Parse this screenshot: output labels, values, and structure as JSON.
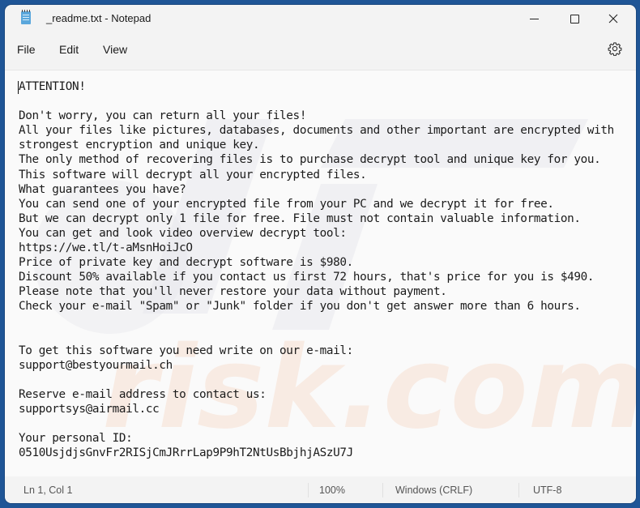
{
  "window": {
    "title": "_readme.txt - Notepad",
    "app_icon": "notepad-icon",
    "controls": {
      "minimize": "minimize-icon",
      "maximize": "maximize-icon",
      "close": "close-icon"
    }
  },
  "menu": {
    "items": [
      {
        "label": "File"
      },
      {
        "label": "Edit"
      },
      {
        "label": "View"
      }
    ],
    "settings_icon": "gear-icon"
  },
  "editor": {
    "lines": [
      "ATTENTION!",
      "",
      "Don't worry, you can return all your files!",
      "All your files like pictures, databases, documents and other important are encrypted with",
      "strongest encryption and unique key.",
      "The only method of recovering files is to purchase decrypt tool and unique key for you.",
      "This software will decrypt all your encrypted files.",
      "What guarantees you have?",
      "You can send one of your encrypted file from your PC and we decrypt it for free.",
      "But we can decrypt only 1 file for free. File must not contain valuable information.",
      "You can get and look video overview decrypt tool:",
      "https://we.tl/t-aMsnHoiJcO",
      "Price of private key and decrypt software is $980.",
      "Discount 50% available if you contact us first 72 hours, that's price for you is $490.",
      "Please note that you'll never restore your data without payment.",
      "Check your e-mail \"Spam\" or \"Junk\" folder if you don't get answer more than 6 hours.",
      "",
      "",
      "To get this software you need write on our e-mail:",
      "support@bestyourmail.ch",
      "",
      "Reserve e-mail address to contact us:",
      "supportsys@airmail.cc",
      "",
      "Your personal ID:",
      "0510UsjdjsGnvFr2RISjCmJRrrLap9P9hT2NtUsBbjhjASzU7J"
    ]
  },
  "statusbar": {
    "position": "Ln 1, Col 1",
    "zoom": "100%",
    "line_ending": "Windows (CRLF)",
    "encoding": "UTF-8"
  },
  "colors": {
    "desktop": "#1f5596",
    "chrome": "#f3f3f3",
    "editor_bg": "#fafafa",
    "text": "#1b1b1b"
  }
}
